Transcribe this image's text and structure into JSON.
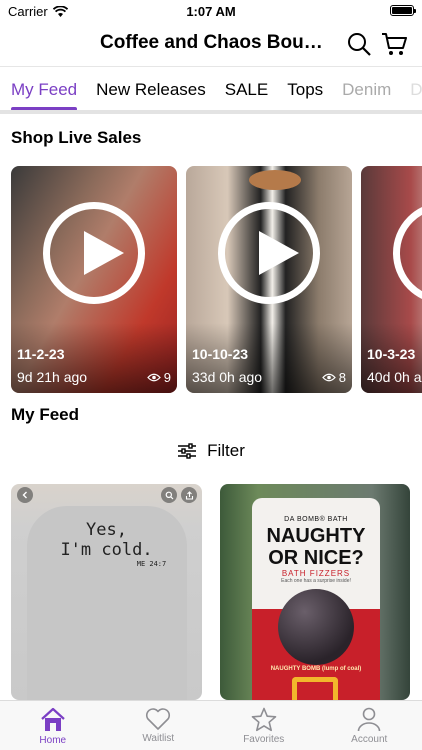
{
  "status_bar": {
    "carrier": "Carrier",
    "time": "1:07 AM"
  },
  "header": {
    "title": "Coffee and Chaos Bouti...",
    "search_icon": "search-icon",
    "cart_icon": "cart-icon"
  },
  "tabs": [
    {
      "label": "My Feed",
      "active": true
    },
    {
      "label": "New Releases"
    },
    {
      "label": "SALE"
    },
    {
      "label": "Tops"
    },
    {
      "label": "Denim"
    },
    {
      "label": "D"
    }
  ],
  "live_sales": {
    "title": "Shop Live Sales",
    "items": [
      {
        "date": "11-2-23",
        "ago": "9d 21h ago",
        "views": "9"
      },
      {
        "date": "10-10-23",
        "ago": "33d 0h ago",
        "views": "8"
      },
      {
        "date": "10-3-23",
        "ago": "40d 0h a"
      }
    ]
  },
  "feed": {
    "title": "My Feed",
    "filter_label": "Filter",
    "items": [
      {
        "shirt_text_1": "Yes,",
        "shirt_text_2": "I'm cold.",
        "shirt_text_3": "ME 24:7"
      },
      {
        "brand": "DA BOMB® BATH",
        "headline_1": "NAUGHTY",
        "headline_2": "OR NICE?",
        "sub": "BATH FIZZERS",
        "tagline": "Each one has a surprise inside!",
        "band": "NAUGHTY BOMB (lump of coal)"
      }
    ]
  },
  "tab_bar": [
    {
      "label": "Home",
      "icon": "home-icon",
      "active": true
    },
    {
      "label": "Waitlist",
      "icon": "heart-icon"
    },
    {
      "label": "Favorites",
      "icon": "star-icon"
    },
    {
      "label": "Account",
      "icon": "person-icon"
    }
  ],
  "colors": {
    "accent": "#7b3fc4"
  }
}
